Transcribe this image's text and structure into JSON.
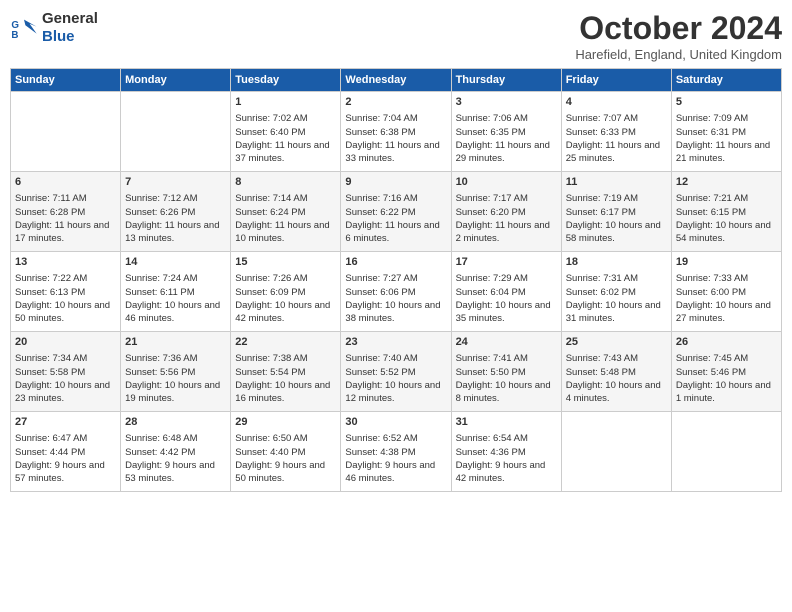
{
  "header": {
    "logo_line1": "General",
    "logo_line2": "Blue",
    "month": "October 2024",
    "location": "Harefield, England, United Kingdom"
  },
  "days_of_week": [
    "Sunday",
    "Monday",
    "Tuesday",
    "Wednesday",
    "Thursday",
    "Friday",
    "Saturday"
  ],
  "weeks": [
    [
      {
        "day": "",
        "content": ""
      },
      {
        "day": "",
        "content": ""
      },
      {
        "day": "1",
        "content": "Sunrise: 7:02 AM\nSunset: 6:40 PM\nDaylight: 11 hours and 37 minutes."
      },
      {
        "day": "2",
        "content": "Sunrise: 7:04 AM\nSunset: 6:38 PM\nDaylight: 11 hours and 33 minutes."
      },
      {
        "day": "3",
        "content": "Sunrise: 7:06 AM\nSunset: 6:35 PM\nDaylight: 11 hours and 29 minutes."
      },
      {
        "day": "4",
        "content": "Sunrise: 7:07 AM\nSunset: 6:33 PM\nDaylight: 11 hours and 25 minutes."
      },
      {
        "day": "5",
        "content": "Sunrise: 7:09 AM\nSunset: 6:31 PM\nDaylight: 11 hours and 21 minutes."
      }
    ],
    [
      {
        "day": "6",
        "content": "Sunrise: 7:11 AM\nSunset: 6:28 PM\nDaylight: 11 hours and 17 minutes."
      },
      {
        "day": "7",
        "content": "Sunrise: 7:12 AM\nSunset: 6:26 PM\nDaylight: 11 hours and 13 minutes."
      },
      {
        "day": "8",
        "content": "Sunrise: 7:14 AM\nSunset: 6:24 PM\nDaylight: 11 hours and 10 minutes."
      },
      {
        "day": "9",
        "content": "Sunrise: 7:16 AM\nSunset: 6:22 PM\nDaylight: 11 hours and 6 minutes."
      },
      {
        "day": "10",
        "content": "Sunrise: 7:17 AM\nSunset: 6:20 PM\nDaylight: 11 hours and 2 minutes."
      },
      {
        "day": "11",
        "content": "Sunrise: 7:19 AM\nSunset: 6:17 PM\nDaylight: 10 hours and 58 minutes."
      },
      {
        "day": "12",
        "content": "Sunrise: 7:21 AM\nSunset: 6:15 PM\nDaylight: 10 hours and 54 minutes."
      }
    ],
    [
      {
        "day": "13",
        "content": "Sunrise: 7:22 AM\nSunset: 6:13 PM\nDaylight: 10 hours and 50 minutes."
      },
      {
        "day": "14",
        "content": "Sunrise: 7:24 AM\nSunset: 6:11 PM\nDaylight: 10 hours and 46 minutes."
      },
      {
        "day": "15",
        "content": "Sunrise: 7:26 AM\nSunset: 6:09 PM\nDaylight: 10 hours and 42 minutes."
      },
      {
        "day": "16",
        "content": "Sunrise: 7:27 AM\nSunset: 6:06 PM\nDaylight: 10 hours and 38 minutes."
      },
      {
        "day": "17",
        "content": "Sunrise: 7:29 AM\nSunset: 6:04 PM\nDaylight: 10 hours and 35 minutes."
      },
      {
        "day": "18",
        "content": "Sunrise: 7:31 AM\nSunset: 6:02 PM\nDaylight: 10 hours and 31 minutes."
      },
      {
        "day": "19",
        "content": "Sunrise: 7:33 AM\nSunset: 6:00 PM\nDaylight: 10 hours and 27 minutes."
      }
    ],
    [
      {
        "day": "20",
        "content": "Sunrise: 7:34 AM\nSunset: 5:58 PM\nDaylight: 10 hours and 23 minutes."
      },
      {
        "day": "21",
        "content": "Sunrise: 7:36 AM\nSunset: 5:56 PM\nDaylight: 10 hours and 19 minutes."
      },
      {
        "day": "22",
        "content": "Sunrise: 7:38 AM\nSunset: 5:54 PM\nDaylight: 10 hours and 16 minutes."
      },
      {
        "day": "23",
        "content": "Sunrise: 7:40 AM\nSunset: 5:52 PM\nDaylight: 10 hours and 12 minutes."
      },
      {
        "day": "24",
        "content": "Sunrise: 7:41 AM\nSunset: 5:50 PM\nDaylight: 10 hours and 8 minutes."
      },
      {
        "day": "25",
        "content": "Sunrise: 7:43 AM\nSunset: 5:48 PM\nDaylight: 10 hours and 4 minutes."
      },
      {
        "day": "26",
        "content": "Sunrise: 7:45 AM\nSunset: 5:46 PM\nDaylight: 10 hours and 1 minute."
      }
    ],
    [
      {
        "day": "27",
        "content": "Sunrise: 6:47 AM\nSunset: 4:44 PM\nDaylight: 9 hours and 57 minutes."
      },
      {
        "day": "28",
        "content": "Sunrise: 6:48 AM\nSunset: 4:42 PM\nDaylight: 9 hours and 53 minutes."
      },
      {
        "day": "29",
        "content": "Sunrise: 6:50 AM\nSunset: 4:40 PM\nDaylight: 9 hours and 50 minutes."
      },
      {
        "day": "30",
        "content": "Sunrise: 6:52 AM\nSunset: 4:38 PM\nDaylight: 9 hours and 46 minutes."
      },
      {
        "day": "31",
        "content": "Sunrise: 6:54 AM\nSunset: 4:36 PM\nDaylight: 9 hours and 42 minutes."
      },
      {
        "day": "",
        "content": ""
      },
      {
        "day": "",
        "content": ""
      }
    ]
  ]
}
